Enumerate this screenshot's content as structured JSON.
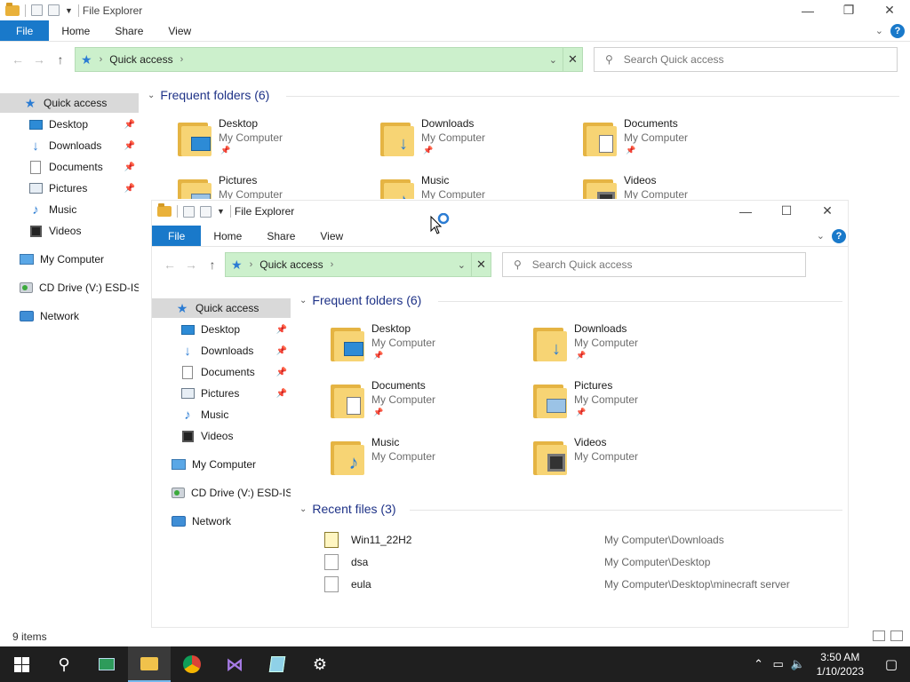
{
  "window_title": "File Explorer",
  "ribbon": {
    "file": "File",
    "home": "Home",
    "share": "Share",
    "view": "View",
    "help": "?"
  },
  "address": {
    "location": "Quick access"
  },
  "search": {
    "placeholder": "Search Quick access"
  },
  "caption": {
    "minimize": "—",
    "maximize": "☐",
    "restore": "❐",
    "close": "✕"
  },
  "sidebar": {
    "quick_access": "Quick access",
    "desktop": "Desktop",
    "downloads": "Downloads",
    "documents": "Documents",
    "pictures": "Pictures",
    "music": "Music",
    "videos": "Videos",
    "my_computer": "My Computer",
    "cd_drive": "CD Drive (V:) ESD-ISO",
    "network": "Network"
  },
  "frequent_header": "Frequent folders (6)",
  "recent_header": "Recent files (3)",
  "folder_location": "My Computer",
  "folders": {
    "desktop": "Desktop",
    "downloads": "Downloads",
    "documents": "Documents",
    "pictures": "Pictures",
    "music": "Music",
    "videos": "Videos"
  },
  "recent_files": [
    {
      "name": "Win11_22H2",
      "path": "My Computer\\Downloads",
      "icon": "iso-file-icon"
    },
    {
      "name": "dsa",
      "path": "My Computer\\Desktop",
      "icon": "text-file-icon"
    },
    {
      "name": "eula",
      "path": "My Computer\\Desktop\\minecraft server",
      "icon": "text-file-icon"
    }
  ],
  "status": {
    "items": "9 items"
  },
  "clock": {
    "time": "3:50 AM",
    "date": "1/10/2023"
  },
  "colors": {
    "accent": "#1979ca",
    "address_bg": "#ccf0cc",
    "taskbar": "#1f1f1f",
    "header": "#1e3287"
  }
}
